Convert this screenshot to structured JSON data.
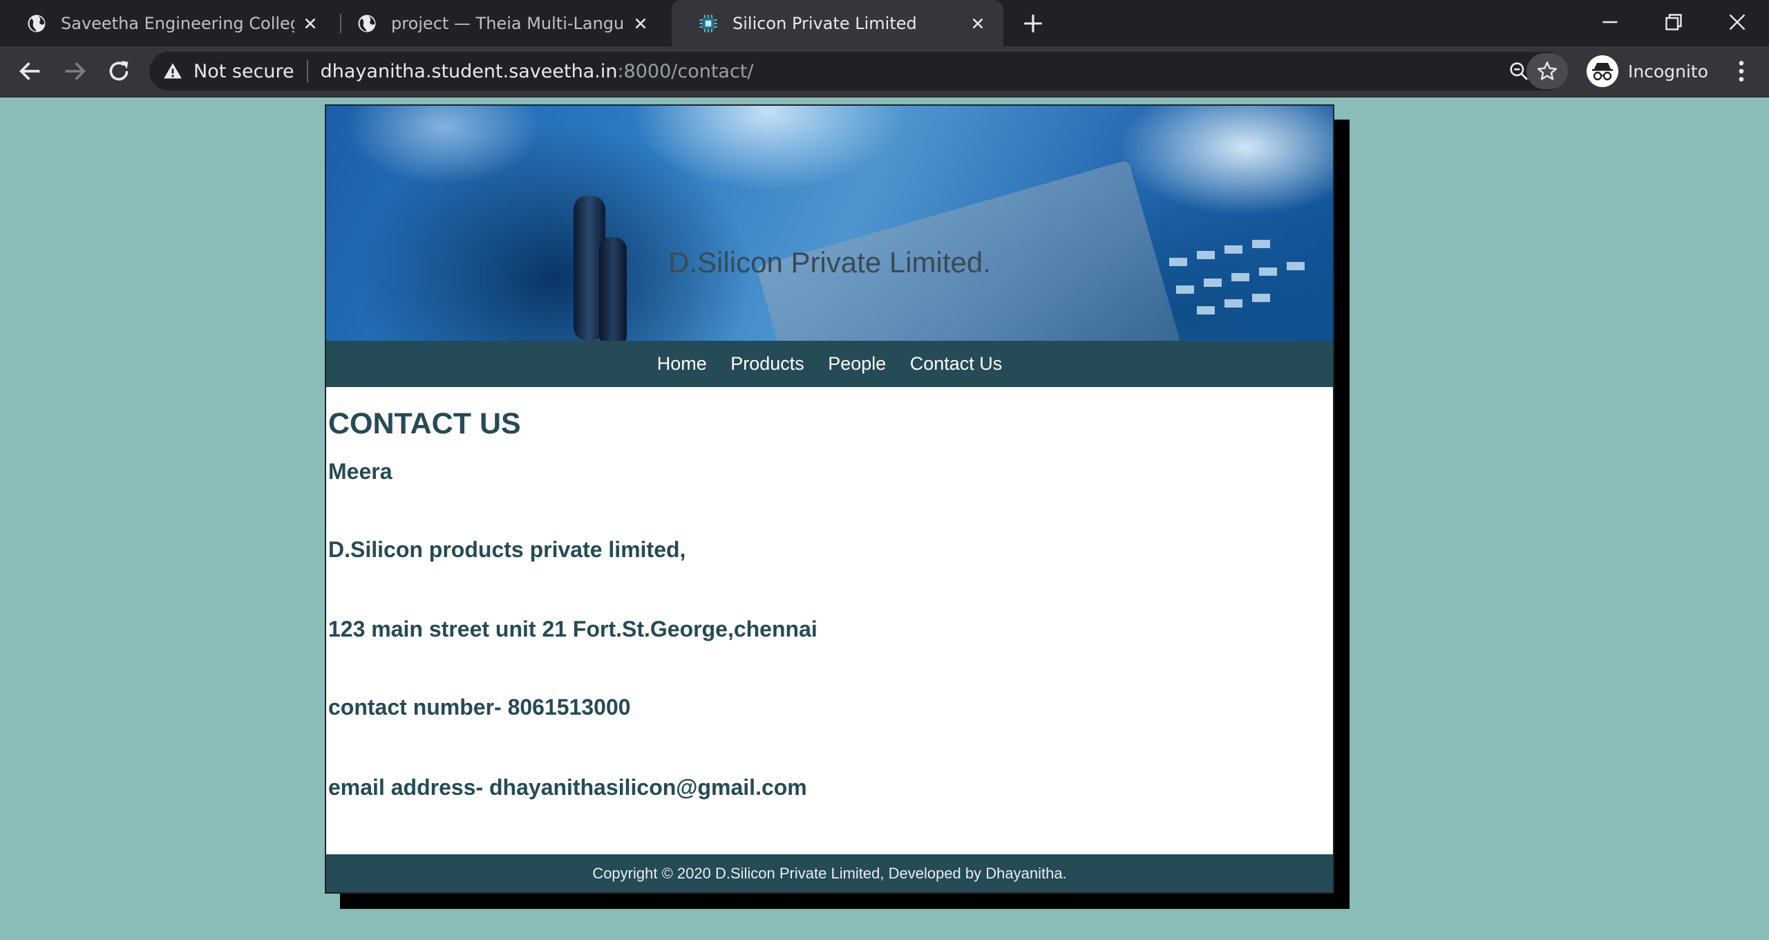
{
  "browser": {
    "tabs": [
      {
        "title": "Saveetha Engineering College",
        "icon": "globe-icon"
      },
      {
        "title": "project — Theia Multi-Language",
        "icon": "globe-icon"
      },
      {
        "title": "Silicon Private Limited",
        "icon": "chip-favicon",
        "active": true
      }
    ],
    "address": {
      "security_label": "Not secure",
      "host": "dhayanitha.student.saveetha.in",
      "path": ":8000/contact/"
    },
    "profile_label": "Incognito"
  },
  "site": {
    "banner_title": "D.Silicon Private Limited.",
    "nav": [
      "Home",
      "Products",
      "People",
      "Contact Us"
    ],
    "heading": "CONTACT US",
    "contact_lines": [
      "Meera",
      "D.Silicon products private limited,",
      "123 main street unit 21 Fort.St.George,chennai",
      "contact number- 8061513000",
      "email address- dhayanithasilicon@gmail.com"
    ],
    "footer": "Copyright © 2020 D.Silicon Private Limited, Developed by Dhayanitha."
  },
  "colors": {
    "page_background": "#8abdb9",
    "accent": "#244b56",
    "chrome_dark": "#202124"
  }
}
